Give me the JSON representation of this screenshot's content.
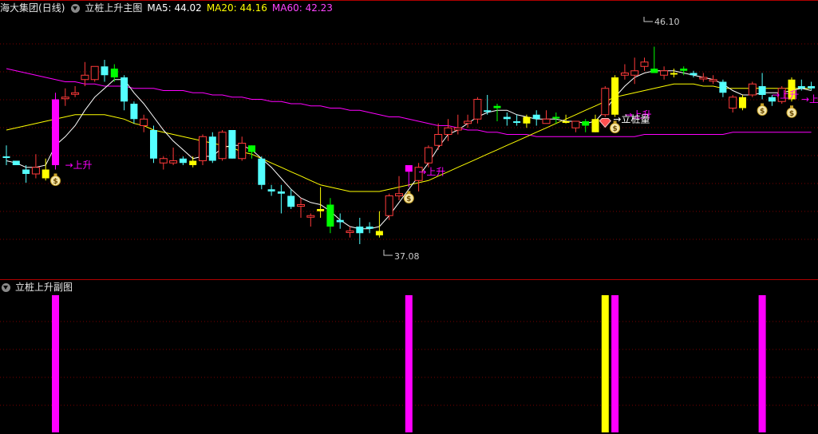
{
  "main_panel": {
    "stock_name": "海大集团",
    "period": "(日线)",
    "indicator_name": "立桩上升主图",
    "ma5_label": "MA5: 44.02",
    "ma20_label": "MA20: 44.16",
    "ma60_label": "MA60: 42.23",
    "high_marker": "46.10",
    "low_marker": "37.08",
    "signal_up_label": "→上升",
    "signal_pile_label": "→立桩量"
  },
  "sub_panel": {
    "indicator_name": "立桩上升副图"
  },
  "colors": {
    "up": "#ff3a3a",
    "down": "#54ffff",
    "ma5": "#ffffff",
    "ma20": "#ffff00",
    "ma60": "#ff00ff",
    "signal_yellow": "#ffff00",
    "signal_green": "#00ff00",
    "signal_magenta": "#ff00ff",
    "grid": "#7a0000"
  },
  "icons": [
    "money-bag-icon",
    "diamond-icon",
    "collapse-triangle-icon"
  ],
  "chart_data": {
    "type": "candlestick",
    "ylim": [
      35.5,
      47.5
    ],
    "candles": [
      {
        "o": 41.1,
        "h": 41.6,
        "l": 40.7,
        "c": 41.1,
        "k": "down"
      },
      {
        "o": 40.7,
        "h": 40.7,
        "l": 40.8,
        "c": 40.9,
        "k": "down"
      },
      {
        "o": 40.5,
        "h": 40.7,
        "l": 39.9,
        "c": 40.3,
        "k": "down"
      },
      {
        "o": 40.3,
        "h": 41.2,
        "l": 40.1,
        "c": 40.6,
        "k": "up"
      },
      {
        "o": 40.1,
        "h": 41.0,
        "l": 40.0,
        "c": 40.5,
        "k": "yellow"
      },
      {
        "o": 40.7,
        "h": 44.0,
        "l": 40.5,
        "c": 43.7,
        "k": "magenta"
      },
      {
        "o": 43.8,
        "h": 44.2,
        "l": 43.4,
        "c": 43.8,
        "k": "up"
      },
      {
        "o": 44.0,
        "h": 44.3,
        "l": 43.8,
        "c": 44.0,
        "k": "up"
      },
      {
        "o": 44.6,
        "h": 45.4,
        "l": 44.3,
        "c": 44.8,
        "k": "up"
      },
      {
        "o": 44.6,
        "h": 45.2,
        "l": 44.5,
        "c": 45.2,
        "k": "up"
      },
      {
        "o": 45.2,
        "h": 45.5,
        "l": 44.5,
        "c": 44.8,
        "k": "down"
      },
      {
        "o": 45.1,
        "h": 45.3,
        "l": 44.5,
        "c": 44.7,
        "k": "green"
      },
      {
        "o": 44.7,
        "h": 44.8,
        "l": 43.2,
        "c": 43.6,
        "k": "down"
      },
      {
        "o": 43.5,
        "h": 43.6,
        "l": 42.6,
        "c": 42.8,
        "k": "down"
      },
      {
        "o": 42.8,
        "h": 43.0,
        "l": 42.2,
        "c": 42.5,
        "k": "up"
      },
      {
        "o": 42.3,
        "h": 42.5,
        "l": 40.8,
        "c": 41.0,
        "k": "down"
      },
      {
        "o": 40.8,
        "h": 41.1,
        "l": 40.5,
        "c": 41.0,
        "k": "up"
      },
      {
        "o": 40.9,
        "h": 41.5,
        "l": 40.7,
        "c": 40.8,
        "k": "up"
      },
      {
        "o": 41.0,
        "h": 41.1,
        "l": 40.7,
        "c": 40.8,
        "k": "down"
      },
      {
        "o": 40.7,
        "h": 41.1,
        "l": 40.6,
        "c": 40.9,
        "k": "yellow"
      },
      {
        "o": 40.9,
        "h": 42.1,
        "l": 40.7,
        "c": 42.0,
        "k": "up"
      },
      {
        "o": 42.0,
        "h": 42.2,
        "l": 40.8,
        "c": 40.9,
        "k": "down"
      },
      {
        "o": 41.0,
        "h": 42.3,
        "l": 40.9,
        "c": 42.2,
        "k": "up"
      },
      {
        "o": 42.3,
        "h": 42.3,
        "l": 41.0,
        "c": 41.0,
        "k": "down"
      },
      {
        "o": 41.0,
        "h": 42.0,
        "l": 40.9,
        "c": 41.7,
        "k": "up"
      },
      {
        "o": 41.3,
        "h": 41.6,
        "l": 41.0,
        "c": 41.6,
        "k": "green"
      },
      {
        "o": 41.0,
        "h": 41.1,
        "l": 39.6,
        "c": 39.8,
        "k": "down"
      },
      {
        "o": 39.6,
        "h": 39.8,
        "l": 39.3,
        "c": 39.5,
        "k": "down"
      },
      {
        "o": 39.5,
        "h": 39.8,
        "l": 38.5,
        "c": 39.4,
        "k": "down"
      },
      {
        "o": 39.3,
        "h": 39.6,
        "l": 38.7,
        "c": 38.8,
        "k": "down"
      },
      {
        "o": 38.9,
        "h": 39.2,
        "l": 38.3,
        "c": 38.9,
        "k": "up"
      },
      {
        "o": 38.4,
        "h": 38.5,
        "l": 37.9,
        "c": 38.4,
        "k": "up"
      },
      {
        "o": 38.6,
        "h": 39.7,
        "l": 38.3,
        "c": 38.7,
        "k": "yellow"
      },
      {
        "o": 38.9,
        "h": 39.2,
        "l": 37.6,
        "c": 37.9,
        "k": "green"
      },
      {
        "o": 38.2,
        "h": 38.5,
        "l": 37.8,
        "c": 38.1,
        "k": "down"
      },
      {
        "o": 37.7,
        "h": 37.9,
        "l": 37.4,
        "c": 37.7,
        "k": "up"
      },
      {
        "o": 37.9,
        "h": 38.3,
        "l": 37.1,
        "c": 37.6,
        "k": "down"
      },
      {
        "o": 37.8,
        "h": 38.1,
        "l": 37.6,
        "c": 37.9,
        "k": "down"
      },
      {
        "o": 37.5,
        "h": 38.6,
        "l": 37.4,
        "c": 37.7,
        "k": "yellow"
      },
      {
        "o": 38.4,
        "h": 39.4,
        "l": 38.2,
        "c": 39.3,
        "k": "up"
      },
      {
        "o": 39.4,
        "h": 40.2,
        "l": 39.1,
        "c": 39.3,
        "k": "up"
      },
      {
        "o": 40.4,
        "h": 40.5,
        "l": 39.7,
        "c": 40.7,
        "k": "magenta"
      },
      {
        "o": 40.0,
        "h": 40.8,
        "l": 39.5,
        "c": 40.6,
        "k": "up"
      },
      {
        "o": 40.8,
        "h": 41.6,
        "l": 40.6,
        "c": 41.5,
        "k": "up"
      },
      {
        "o": 41.6,
        "h": 42.6,
        "l": 41.4,
        "c": 42.1,
        "k": "up"
      },
      {
        "o": 42.1,
        "h": 42.8,
        "l": 41.8,
        "c": 42.4,
        "k": "up"
      },
      {
        "o": 42.3,
        "h": 43.0,
        "l": 42.1,
        "c": 42.4,
        "k": "up"
      },
      {
        "o": 42.6,
        "h": 43.0,
        "l": 42.4,
        "c": 42.7,
        "k": "up"
      },
      {
        "o": 42.8,
        "h": 43.8,
        "l": 42.6,
        "c": 43.7,
        "k": "up"
      },
      {
        "o": 43.2,
        "h": 43.9,
        "l": 43.0,
        "c": 43.2,
        "k": "down"
      },
      {
        "o": 43.3,
        "h": 43.5,
        "l": 42.7,
        "c": 43.4,
        "k": "green"
      },
      {
        "o": 42.9,
        "h": 43.1,
        "l": 42.5,
        "c": 42.8,
        "k": "down"
      },
      {
        "o": 42.7,
        "h": 43.0,
        "l": 42.5,
        "c": 42.7,
        "k": "down"
      },
      {
        "o": 42.6,
        "h": 43.0,
        "l": 42.4,
        "c": 42.9,
        "k": "yellow"
      },
      {
        "o": 42.8,
        "h": 43.2,
        "l": 42.5,
        "c": 43.0,
        "k": "down"
      },
      {
        "o": 42.8,
        "h": 43.2,
        "l": 42.6,
        "c": 42.6,
        "k": "up"
      },
      {
        "o": 42.9,
        "h": 43.1,
        "l": 42.6,
        "c": 42.9,
        "k": "green"
      },
      {
        "o": 42.7,
        "h": 43.0,
        "l": 42.6,
        "c": 42.7,
        "k": "yellow"
      },
      {
        "o": 42.4,
        "h": 42.7,
        "l": 42.2,
        "c": 42.7,
        "k": "up"
      },
      {
        "o": 42.7,
        "h": 42.8,
        "l": 42.2,
        "c": 42.5,
        "k": "green"
      },
      {
        "o": 42.2,
        "h": 43.0,
        "l": 42.2,
        "c": 42.8,
        "k": "yellow"
      },
      {
        "o": 43.0,
        "h": 44.3,
        "l": 42.9,
        "c": 44.2,
        "k": "up"
      },
      {
        "o": 43.0,
        "h": 44.8,
        "l": 42.9,
        "c": 44.7,
        "k": "yellow"
      },
      {
        "o": 44.8,
        "h": 45.3,
        "l": 44.6,
        "c": 44.9,
        "k": "up"
      },
      {
        "o": 45.0,
        "h": 45.6,
        "l": 44.4,
        "c": 44.8,
        "k": "up"
      },
      {
        "o": 45.2,
        "h": 45.6,
        "l": 45.0,
        "c": 45.4,
        "k": "up"
      },
      {
        "o": 45.1,
        "h": 46.1,
        "l": 45.0,
        "c": 44.9,
        "k": "green"
      },
      {
        "o": 44.8,
        "h": 45.2,
        "l": 44.6,
        "c": 45.0,
        "k": "up"
      },
      {
        "o": 44.9,
        "h": 45.1,
        "l": 44.7,
        "c": 44.9,
        "k": "yellow"
      },
      {
        "o": 45.1,
        "h": 45.2,
        "l": 44.8,
        "c": 45.0,
        "k": "green"
      },
      {
        "o": 44.9,
        "h": 45.0,
        "l": 44.7,
        "c": 44.8,
        "k": "down"
      },
      {
        "o": 44.7,
        "h": 44.9,
        "l": 44.5,
        "c": 44.7,
        "k": "up"
      },
      {
        "o": 44.6,
        "h": 44.8,
        "l": 44.4,
        "c": 44.6,
        "k": "up"
      },
      {
        "o": 44.5,
        "h": 44.6,
        "l": 43.8,
        "c": 44.0,
        "k": "down"
      },
      {
        "o": 43.8,
        "h": 43.9,
        "l": 43.1,
        "c": 43.3,
        "k": "up"
      },
      {
        "o": 43.3,
        "h": 43.9,
        "l": 43.2,
        "c": 43.8,
        "k": "yellow"
      },
      {
        "o": 43.9,
        "h": 44.5,
        "l": 43.8,
        "c": 44.4,
        "k": "up"
      },
      {
        "o": 43.9,
        "h": 44.9,
        "l": 43.7,
        "c": 44.3,
        "k": "down"
      },
      {
        "o": 43.6,
        "h": 43.9,
        "l": 43.4,
        "c": 43.8,
        "k": "down"
      },
      {
        "o": 43.6,
        "h": 44.3,
        "l": 43.5,
        "c": 44.2,
        "k": "up"
      },
      {
        "o": 43.7,
        "h": 44.7,
        "l": 43.6,
        "c": 44.6,
        "k": "yellow"
      },
      {
        "o": 44.2,
        "h": 44.6,
        "l": 44.1,
        "c": 44.3,
        "k": "down"
      },
      {
        "o": 44.2,
        "h": 44.5,
        "l": 44.1,
        "c": 44.3,
        "k": "down"
      }
    ],
    "ma5": [
      40.9,
      40.8,
      40.6,
      40.6,
      40.7,
      41.6,
      42.0,
      42.5,
      43.2,
      43.8,
      44.2,
      44.6,
      44.6,
      44.0,
      43.5,
      42.9,
      42.3,
      41.8,
      41.4,
      41.0,
      41.1,
      41.1,
      41.5,
      41.6,
      41.6,
      41.4,
      41.0,
      40.6,
      40.1,
      39.6,
      39.2,
      39.0,
      38.9,
      38.6,
      38.2,
      37.9,
      37.8,
      37.8,
      37.9,
      38.4,
      39.0,
      39.6,
      40.2,
      40.8,
      41.5,
      42.1,
      42.3,
      42.6,
      42.9,
      43.1,
      43.2,
      43.2,
      43.0,
      42.9,
      42.8,
      42.8,
      42.8,
      42.7,
      42.7,
      42.6,
      42.7,
      43.2,
      43.8,
      44.3,
      44.7,
      44.9,
      45.0,
      45.0,
      45.0,
      44.9,
      44.8,
      44.7,
      44.6,
      44.4,
      44.1,
      43.9,
      43.9,
      44.0,
      44.0,
      44.0,
      44.1,
      44.2,
      44.1
    ],
    "ma20": [
      42.3,
      42.4,
      42.5,
      42.6,
      42.7,
      42.8,
      42.9,
      43.0,
      43.0,
      43.0,
      43.0,
      42.9,
      42.8,
      42.6,
      42.5,
      42.3,
      42.2,
      42.1,
      42.0,
      41.9,
      41.8,
      41.7,
      41.6,
      41.5,
      41.3,
      41.2,
      41.0,
      40.8,
      40.6,
      40.4,
      40.2,
      40.0,
      39.8,
      39.7,
      39.6,
      39.5,
      39.5,
      39.5,
      39.5,
      39.6,
      39.7,
      39.8,
      39.9,
      40.0,
      40.2,
      40.4,
      40.6,
      40.8,
      41.0,
      41.2,
      41.4,
      41.6,
      41.8,
      42.0,
      42.2,
      42.4,
      42.6,
      42.8,
      43.0,
      43.2,
      43.4,
      43.6,
      43.8,
      43.9,
      44.0,
      44.1,
      44.2,
      44.3,
      44.4,
      44.4,
      44.4,
      44.3,
      44.3,
      44.2,
      44.2,
      44.2,
      44.2,
      44.2,
      44.2,
      44.2,
      44.2,
      44.2,
      44.2
    ],
    "ma60": [
      45.1,
      45.0,
      44.9,
      44.8,
      44.7,
      44.6,
      44.5,
      44.5,
      44.4,
      44.4,
      44.3,
      44.3,
      44.3,
      44.2,
      44.2,
      44.2,
      44.1,
      44.1,
      44.1,
      44.0,
      44.0,
      43.9,
      43.9,
      43.8,
      43.8,
      43.7,
      43.7,
      43.6,
      43.6,
      43.5,
      43.5,
      43.4,
      43.4,
      43.3,
      43.3,
      43.2,
      43.2,
      43.1,
      43.0,
      42.9,
      42.9,
      42.8,
      42.7,
      42.6,
      42.5,
      42.5,
      42.4,
      42.3,
      42.3,
      42.2,
      42.2,
      42.1,
      42.1,
      42.1,
      42.0,
      42.0,
      42.0,
      42.0,
      42.0,
      42.0,
      42.0,
      42.0,
      42.0,
      42.0,
      42.0,
      42.1,
      42.1,
      42.1,
      42.1,
      42.1,
      42.1,
      42.1,
      42.1,
      42.1,
      42.2,
      42.2,
      42.2,
      42.2,
      42.2,
      42.2,
      42.2,
      42.2,
      42.2
    ],
    "signals_up": [
      5,
      41,
      62,
      77,
      80
    ],
    "signal_pile": [
      61
    ],
    "sub_bars": [
      {
        "i": 5,
        "kind": "magenta",
        "value": 1
      },
      {
        "i": 41,
        "kind": "magenta",
        "value": 1
      },
      {
        "i": 61,
        "kind": "yellow",
        "value": 1
      },
      {
        "i": 62,
        "kind": "magenta",
        "value": 1
      },
      {
        "i": 77,
        "kind": "magenta",
        "value": 1
      }
    ]
  }
}
